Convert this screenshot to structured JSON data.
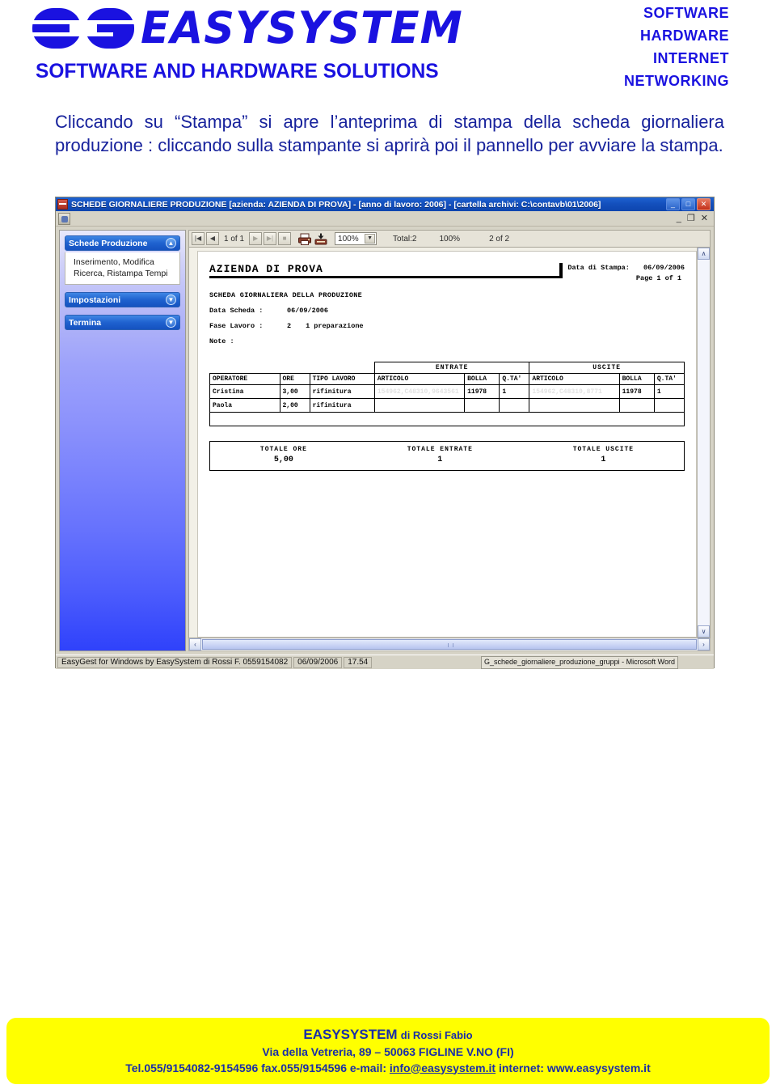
{
  "header": {
    "logo_word": "EASYSYSTEM",
    "logo_mark": "es-monogram",
    "tagline": "SOFTWARE AND HARDWARE SOLUTIONS",
    "services": [
      "SOFTWARE",
      "HARDWARE",
      "INTERNET",
      "NETWORKING"
    ]
  },
  "body": {
    "paragraph": "Cliccando su “Stampa” si apre l’anteprima di stampa della scheda giornaliera produzione : cliccando sulla stampante si aprirà poi il pannello per avviare la stampa."
  },
  "app": {
    "title": "SCHEDE GIORNALIERE PRODUZIONE [azienda: AZIENDA DI PROVA] - [anno di lavoro: 2006] - [cartella archivi: C:\\contavb\\01\\2006]",
    "window_buttons": {
      "minimize": "_",
      "maximize": "□",
      "close": "✕"
    },
    "mdi_buttons": {
      "minimize": "_",
      "restore": "❐",
      "close": "✕"
    },
    "sidebar": {
      "panels": [
        {
          "title": "Schede Produzione",
          "state": "expanded",
          "chevron": "▲",
          "items": [
            "Inserimento, Modifica",
            "Ricerca, Ristampa Tempi"
          ]
        },
        {
          "title": "Impostazioni",
          "state": "collapsed",
          "chevron": "▼",
          "items": []
        },
        {
          "title": "Termina",
          "state": "collapsed",
          "chevron": "▼",
          "items": []
        }
      ]
    },
    "toolbar": {
      "first_page": "|◀",
      "prev_page": "◀",
      "page_indicator": "1 of 1",
      "next_page": "▶",
      "last_page": "▶|",
      "stop": "■",
      "print_icon": "printer-icon",
      "export_icon": "export-icon",
      "zoom_value": "100%",
      "zoom_arrow": "▼",
      "total_label": "Total:2",
      "percent_label": "100%",
      "record_label": "2 of 2"
    },
    "report": {
      "company": "AZIENDA DI PROVA",
      "print_date_label": "Data di Stampa:",
      "print_date_value": "06/09/2006",
      "page_label": "Page 1 of 1",
      "subtitle": "SCHEDA GIORNALIERA DELLA PRODUZIONE",
      "fields": [
        {
          "label": "Data Scheda :",
          "value": "06/09/2006",
          "value2": ""
        },
        {
          "label": "Fase Lavoro :",
          "value": "2",
          "value2": "1 preparazione"
        },
        {
          "label": "Note :",
          "value": "",
          "value2": ""
        }
      ],
      "group_headers": {
        "entrate": "ENTRATE",
        "uscite": "USCITE"
      },
      "columns": [
        "OPERATORE",
        "ORE",
        "TIPO LAVORO",
        "ARTICOLO",
        "BOLLA",
        "Q.TA'",
        "ARTICOLO",
        "BOLLA",
        "Q.TA'"
      ],
      "rows": [
        {
          "operatore": "Cristina",
          "ore": "3,00",
          "tipo_lavoro": "rifinitura",
          "entrate_articolo": "154962,C48310,9643561",
          "entrate_bolla": "11978",
          "entrate_qta": "1",
          "uscite_articolo": "154962,C48310,8771",
          "uscite_bolla": "11978",
          "uscite_qta": "1"
        },
        {
          "operatore": "Paola",
          "ore": "2,00",
          "tipo_lavoro": "rifinitura",
          "entrate_articolo": "",
          "entrate_bolla": "",
          "entrate_qta": "",
          "uscite_articolo": "",
          "uscite_bolla": "",
          "uscite_qta": ""
        }
      ],
      "totals": [
        {
          "caption": "TOTALE ORE",
          "value": "5,00"
        },
        {
          "caption": "TOTALE ENTRATE",
          "value": "1"
        },
        {
          "caption": "TOTALE USCITE",
          "value": "1"
        }
      ]
    },
    "statusbar": {
      "app_credit": "EasyGest for Windows by EasySystem di Rossi F.  0559154082",
      "date": "06/09/2006",
      "time": "17.54",
      "taskbar_item": "G_schede_giornaliere_produzione_gruppi - Microsoft Word"
    },
    "scrollbars": {
      "up_arrow": "∧",
      "down_arrow": "∨",
      "left_arrow": "‹",
      "right_arrow": "›"
    }
  },
  "footer": {
    "company_brand": "EASYSYSTEM",
    "company_owner": "di Rossi Fabio",
    "address": "Via della Vetreria, 89 – 50063 FIGLINE V.NO (FI)",
    "contact_prefix": "Tel.055/9154082-9154596 fax.055/9154596 e-mail: ",
    "contact_email": "info@easysystem.it",
    "contact_suffix": " internet: www.easysystem.it"
  },
  "colors": {
    "brand_blue": "#1a12e0",
    "text_blue": "#17229c",
    "footer_yellow": "#ffff00",
    "title_blue": "#1450bd"
  }
}
